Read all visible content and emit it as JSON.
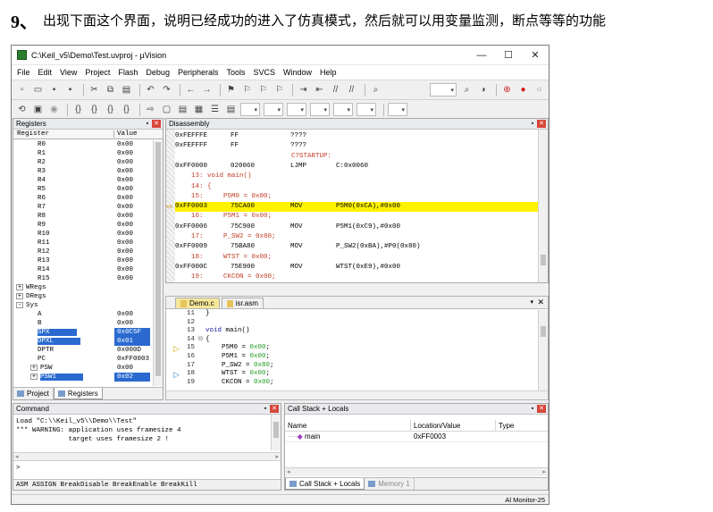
{
  "heading": {
    "number": "9、",
    "text": "出现下面这个界面，说明已经成功的进入了仿真模式，然后就可以用变量监测，断点等等的功能"
  },
  "window": {
    "title": "C:\\Keil_v5\\Demo\\Test.uvproj - µVision"
  },
  "menu": [
    "File",
    "Edit",
    "View",
    "Project",
    "Flash",
    "Debug",
    "Peripherals",
    "Tools",
    "SVCS",
    "Window",
    "Help"
  ],
  "registers": {
    "title": "Registers",
    "col_register": "Register",
    "col_value": "Value",
    "rows": [
      {
        "name": "R0",
        "value": "0x00",
        "indent": 3
      },
      {
        "name": "R1",
        "value": "0x00",
        "indent": 3
      },
      {
        "name": "R2",
        "value": "0x00",
        "indent": 3
      },
      {
        "name": "R3",
        "value": "0x00",
        "indent": 3
      },
      {
        "name": "R4",
        "value": "0x00",
        "indent": 3
      },
      {
        "name": "R5",
        "value": "0x00",
        "indent": 3
      },
      {
        "name": "R6",
        "value": "0x00",
        "indent": 3
      },
      {
        "name": "R7",
        "value": "0x00",
        "indent": 3
      },
      {
        "name": "R8",
        "value": "0x00",
        "indent": 3
      },
      {
        "name": "R9",
        "value": "0x00",
        "indent": 3
      },
      {
        "name": "R10",
        "value": "0x00",
        "indent": 3
      },
      {
        "name": "R11",
        "value": "0x00",
        "indent": 3
      },
      {
        "name": "R12",
        "value": "0x00",
        "indent": 3
      },
      {
        "name": "R13",
        "value": "0x00",
        "indent": 3
      },
      {
        "name": "R14",
        "value": "0x00",
        "indent": 3
      },
      {
        "name": "R15",
        "value": "0x00",
        "indent": 3
      },
      {
        "name": "WRegs",
        "value": "",
        "indent": 0,
        "toggle": "+"
      },
      {
        "name": "DRegs",
        "value": "",
        "indent": 0,
        "toggle": "+"
      },
      {
        "name": "Sys",
        "value": "",
        "indent": 0,
        "toggle": "-"
      },
      {
        "name": "A",
        "value": "0x00",
        "indent": 3
      },
      {
        "name": "B",
        "value": "0x00",
        "indent": 3
      },
      {
        "name": "SPX",
        "value": "0x0C5F",
        "indent": 3,
        "selected": true
      },
      {
        "name": "DPXL",
        "value": "0x01",
        "indent": 3,
        "selected": true
      },
      {
        "name": "DPTR",
        "value": "0x000D",
        "indent": 3
      },
      {
        "name": "PC",
        "value": "0xFF0003",
        "indent": 3
      },
      {
        "name": "PSW",
        "value": "0x00",
        "indent": 2,
        "toggle": "+"
      },
      {
        "name": "PSW1",
        "value": "0x02",
        "indent": 2,
        "toggle": "+",
        "selected": true
      }
    ],
    "tabs": [
      "Project",
      "Registers"
    ]
  },
  "disassembly": {
    "title": "Disassembly",
    "lines": [
      {
        "type": "asm",
        "addr": "0xFEFFFE",
        "code": "FF",
        "op": "????",
        "args": ""
      },
      {
        "type": "asm",
        "addr": "0xFEFFFF",
        "code": "FF",
        "op": "????",
        "args": ""
      },
      {
        "type": "label",
        "text": "C?STARTUP:"
      },
      {
        "type": "asm",
        "addr": "0xFF0000",
        "code": "020060",
        "op": "LJMP",
        "args": "C:0x0060"
      },
      {
        "type": "src",
        "text": "    13: void main()"
      },
      {
        "type": "src",
        "text": "    14: {"
      },
      {
        "type": "src",
        "text": "    15:     P5M0 = 0x00;"
      },
      {
        "type": "asm",
        "addr": "0xFF0003",
        "code": "75CA00",
        "op": "MOV",
        "args": "P5M0(0xCA),#0x00",
        "current": true
      },
      {
        "type": "src",
        "text": "    16:     P5M1 = 0x00;"
      },
      {
        "type": "asm",
        "addr": "0xFF0006",
        "code": "75C900",
        "op": "MOV",
        "args": "P5M1(0xC9),#0x00"
      },
      {
        "type": "src",
        "text": "    17:     P_SW2 = 0x80;"
      },
      {
        "type": "asm",
        "addr": "0xFF0009",
        "code": "75BA80",
        "op": "MOV",
        "args": "P_SW2(0xBA),#P0(0x80)"
      },
      {
        "type": "src",
        "text": "    18:     WTST = 0x00;"
      },
      {
        "type": "asm",
        "addr": "0xFF000C",
        "code": "75E900",
        "op": "MOV",
        "args": "WTST(0xE9),#0x00"
      },
      {
        "type": "src",
        "text": "    19:     CKCON = 0x00;"
      }
    ]
  },
  "editor": {
    "tabs": [
      "Demo.c",
      "isr.asm"
    ],
    "lines": [
      {
        "ln": "11",
        "fold": "",
        "text": "}"
      },
      {
        "ln": "12",
        "fold": "",
        "text": ""
      },
      {
        "ln": "13",
        "fold": "",
        "text": "void main()"
      },
      {
        "ln": "14",
        "fold": "⊟",
        "text": "{"
      },
      {
        "ln": "15",
        "fold": "",
        "text": "    P5M0 = 0x00;",
        "marker": "current"
      },
      {
        "ln": "16",
        "fold": "",
        "text": "    P5M1 = 0x00;"
      },
      {
        "ln": "17",
        "fold": "",
        "text": "    P_SW2 = 0x80;"
      },
      {
        "ln": "18",
        "fold": "",
        "text": "    WTST = 0x00;",
        "marker": "next"
      },
      {
        "ln": "19",
        "fold": "",
        "text": "    CKCON = 0x00;"
      }
    ]
  },
  "command": {
    "title": "Command",
    "output": [
      "Load \"C:\\\\Keil_v5\\\\Demo\\\\Test\"",
      "*** WARNING: application uses framesize 4",
      "             target uses framesize 2 !"
    ],
    "prompt": ">",
    "status": "ASM ASSIGN BreakDisable BreakEnable BreakKill"
  },
  "callstack": {
    "title": "Call Stack + Locals",
    "columns": [
      "Name",
      "Location/Value",
      "Type"
    ],
    "rows": [
      {
        "name": "main",
        "location": "0xFF0003",
        "type": ""
      }
    ],
    "tabs": [
      "Call Stack + Locals",
      "Memory 1"
    ]
  },
  "status": {
    "right": "Al Monitor-25"
  },
  "colors": {
    "highlight": "#fff200",
    "selection": "#2a6ad0",
    "source_text": "#c23b22",
    "number_literal": "#1e9c1e"
  }
}
